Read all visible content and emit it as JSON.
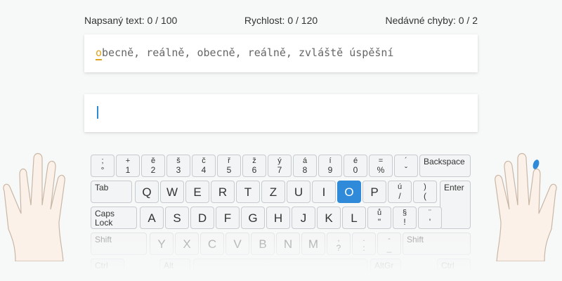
{
  "stats": {
    "typed": "Napsaný text: 0 / 100",
    "speed": "Rychlost: 0 / 120",
    "errors": "Nedávné chyby: 0 / 2"
  },
  "lesson": {
    "current_char": "o",
    "remaining_text": "becně, reálně, obecně, reálně, zvláště úspěšní"
  },
  "input": {
    "value": ""
  },
  "keyboard": {
    "highlighted_key": "O",
    "row1": [
      {
        "top": ";",
        "bot": "°"
      },
      {
        "top": "+",
        "bot": "1"
      },
      {
        "top": "ě",
        "bot": "2"
      },
      {
        "top": "š",
        "bot": "3"
      },
      {
        "top": "č",
        "bot": "4"
      },
      {
        "top": "ř",
        "bot": "5"
      },
      {
        "top": "ž",
        "bot": "6"
      },
      {
        "top": "ý",
        "bot": "7"
      },
      {
        "top": "á",
        "bot": "8"
      },
      {
        "top": "í",
        "bot": "9"
      },
      {
        "top": "é",
        "bot": "0"
      },
      {
        "top": "=",
        "bot": "%"
      },
      {
        "top": "´",
        "bot": "ˇ"
      }
    ],
    "backspace": "Backspace",
    "tab": "Tab",
    "row2": [
      "Q",
      "W",
      "E",
      "R",
      "T",
      "Z",
      "U",
      "I",
      "O",
      "P"
    ],
    "row2_extra": [
      {
        "top": "ú",
        "bot": "/"
      },
      {
        "top": ")",
        "bot": "("
      }
    ],
    "enter": "Enter",
    "caps_lock": "Caps Lock",
    "row3": [
      "A",
      "S",
      "D",
      "F",
      "G",
      "H",
      "J",
      "K",
      "L"
    ],
    "row3_extra": [
      {
        "top": "ů",
        "bot": "\""
      },
      {
        "top": "§",
        "bot": "!"
      },
      {
        "top": "¨",
        "bot": "'"
      }
    ],
    "shift_left": "Shift",
    "row4": [
      "Y",
      "X",
      "C",
      "V",
      "B",
      "N",
      "M"
    ],
    "row4_extra": [
      {
        "top": ",",
        "bot": "?"
      },
      {
        "top": ".",
        "bot": ":"
      },
      {
        "top": "-",
        "bot": "_"
      }
    ],
    "shift_right": "Shift",
    "ctrl_left": "Ctrl",
    "alt_left": "Alt",
    "altgr": "AltGr",
    "ctrl_right": "Ctrl"
  },
  "colors": {
    "accent": "#2f8ad9",
    "cursor_char": "#e0a41c",
    "finger_marker": "#2f8ad9"
  }
}
